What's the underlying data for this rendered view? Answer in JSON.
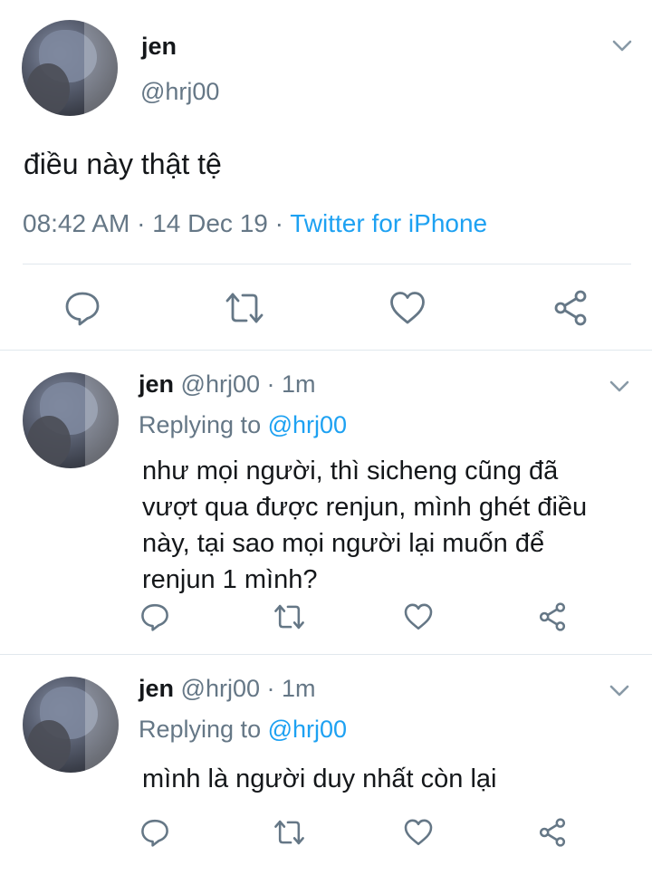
{
  "main_tweet": {
    "display_name": "jen",
    "handle": "@hrj00",
    "text": "điều này thật tệ",
    "time": "08:42 AM",
    "date": "14 Dec 19",
    "source": "Twitter for iPhone",
    "separator": "·"
  },
  "replies": [
    {
      "display_name": "jen",
      "handle_time": "@hrj00 · 1m",
      "replying_prefix": "Replying to",
      "replying_to": "@hrj00",
      "text_lines": [
        "như mọi người, thì sicheng cũng đã",
        "vượt qua được renjun, mình ghét điều",
        "này, tại sao mọi người lại muốn để",
        "renjun 1 mình?"
      ]
    },
    {
      "display_name": "jen",
      "handle_time": "@hrj00 · 1m",
      "replying_prefix": "Replying to",
      "replying_to": "@hrj00",
      "text_lines": [
        "mình là người duy nhất còn lại"
      ]
    }
  ],
  "icons": {
    "reply": "reply-icon",
    "retweet": "retweet-icon",
    "like": "like-icon",
    "share": "share-icon",
    "menu": "chevron-down-icon"
  },
  "colors": {
    "accent": "#1da1f2",
    "muted": "#657786",
    "text": "#14171a",
    "divider": "#e1e8ed"
  }
}
